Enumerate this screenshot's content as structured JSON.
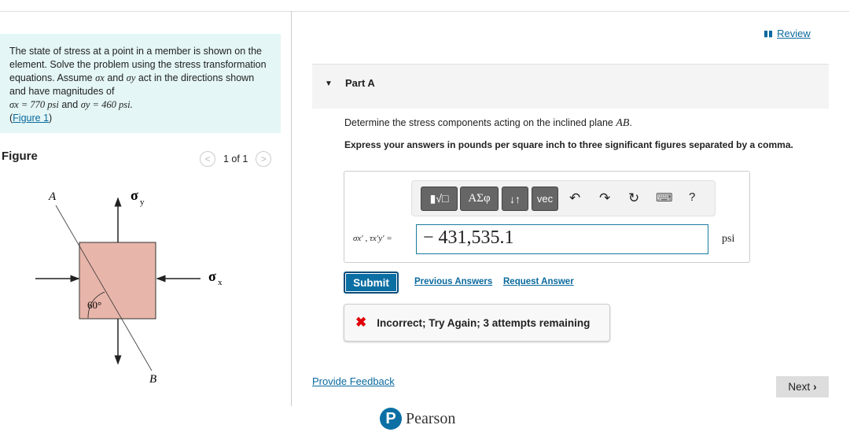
{
  "problem": {
    "text": "The state of stress at a point in a member is shown on the element. Solve the problem using the stress transformation equations. Assume",
    "sx": "σx",
    "and1": "and",
    "sy": "σy",
    "text2": "act in the directions shown and have magnitudes of",
    "eq1": "σx = 770 psi",
    "and2": "and",
    "eq2": "σy = 460 psi.",
    "fig_link": "Figure 1",
    "fig_open": "(",
    "fig_close": ")"
  },
  "figure": {
    "title": "Figure",
    "pager": "1 of 1",
    "label_a": "A",
    "label_b": "B",
    "sigma_y": "σ",
    "sub_y": "y",
    "sigma_x": "σ",
    "sub_x": "x",
    "angle": "60°",
    "element_color": "#e8b5aa"
  },
  "review": "Review",
  "part": {
    "label": "Part A",
    "question": "Determine the stress components acting on the inclined plane",
    "plane": "AB",
    "question_end": ".",
    "instruction": "Express your answers in pounds per square inch to three significant figures separated by a comma."
  },
  "toolbar": {
    "template": "▮√□",
    "greek": "ΑΣφ",
    "arrows": "↓↑",
    "vec": "vec",
    "undo": "↶",
    "redo": "↷",
    "reset": "↻",
    "keyboard": "⌨",
    "help": "?"
  },
  "answer": {
    "lhs": "σx′ , τx′y′ =",
    "value": "− 431,535.1",
    "unit": "psi"
  },
  "actions": {
    "submit": "Submit",
    "previous": "Previous Answers",
    "request": "Request Answer"
  },
  "feedback": {
    "icon": "✖",
    "message": "Incorrect; Try Again; 3 attempts remaining"
  },
  "footer": {
    "provide_feedback": "Provide Feedback",
    "next": "Next",
    "brand": "Pearson",
    "brand_logo": "P"
  },
  "colors": {
    "accent": "#0b6fa4",
    "error": "#e0000a",
    "problem_bg": "#e4f6f6"
  }
}
